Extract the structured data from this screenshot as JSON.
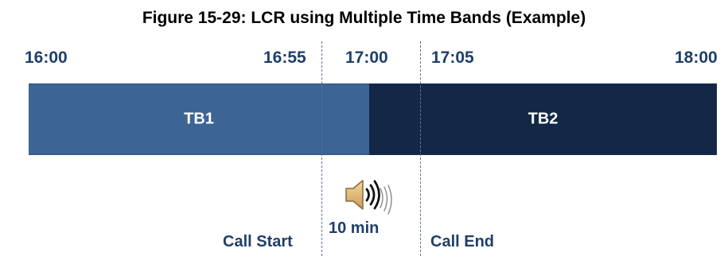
{
  "figure": {
    "title": "Figure 15-29: LCR using Multiple Time Bands (Example)"
  },
  "timeline": {
    "ticks": [
      "16:00",
      "16:55",
      "17:00",
      "17:05",
      "18:00"
    ]
  },
  "bands": [
    {
      "label": "TB1",
      "color": "#3c6494"
    },
    {
      "label": "TB2",
      "color": "#132846"
    }
  ],
  "call": {
    "start_label": "Call Start",
    "end_label": "Call End",
    "duration_label": "10 min",
    "icon": "speaker-icon"
  }
}
